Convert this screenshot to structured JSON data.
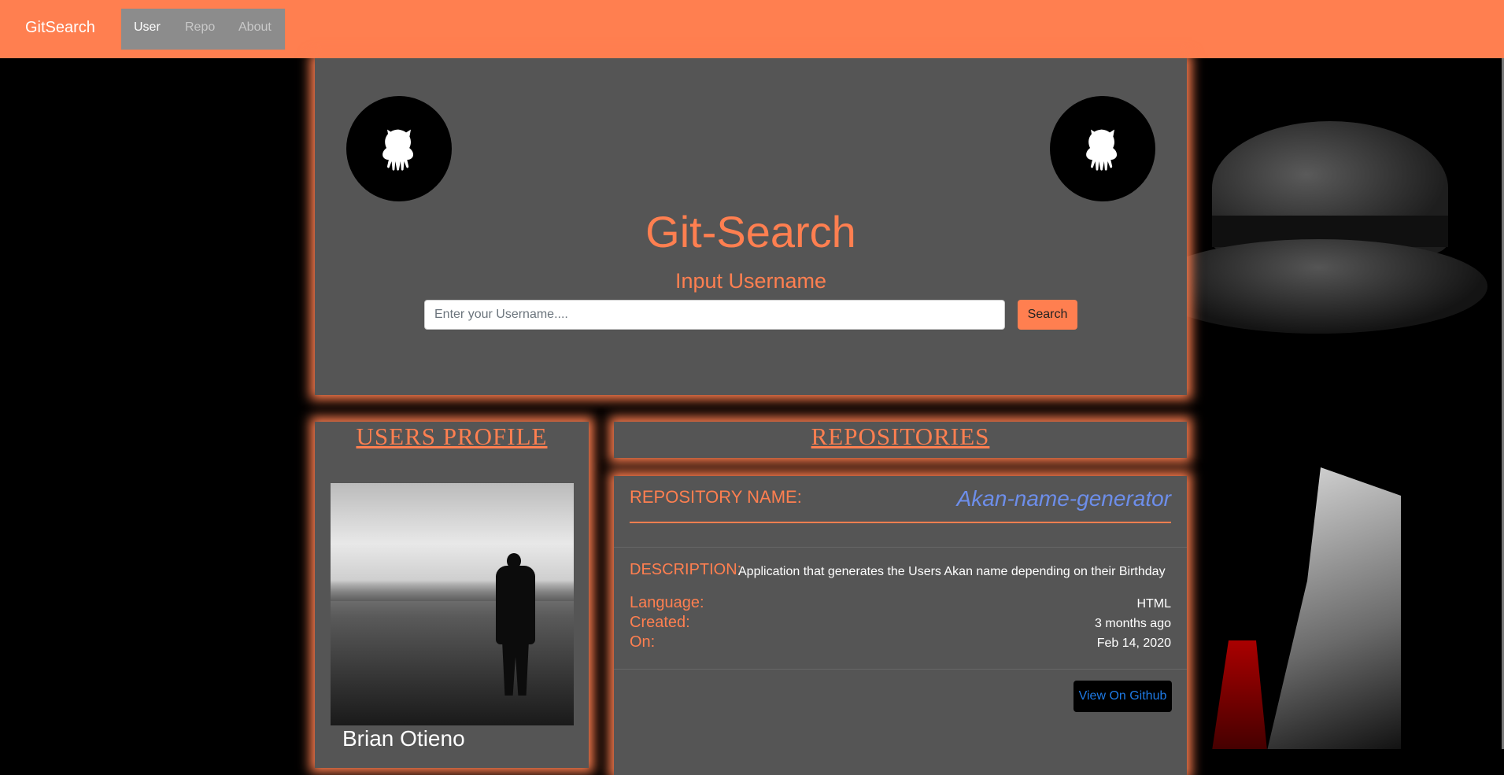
{
  "navbar": {
    "brand": "GitSearch",
    "links": [
      {
        "label": "User",
        "active": true
      },
      {
        "label": "Repo",
        "active": false
      },
      {
        "label": "About",
        "active": false
      }
    ],
    "color": "#ff7f50"
  },
  "hero": {
    "icon": "github-octocat-icon",
    "title": "Git-Search",
    "subtitle": "Input Username",
    "search": {
      "placeholder": "Enter your Username....",
      "value": "",
      "button_label": "Search"
    }
  },
  "profile": {
    "heading": "USERS PROFILE",
    "name": "Brian Otieno"
  },
  "repositories": {
    "heading": "REPOSITORIES",
    "items": [
      {
        "name_label": "REPOSITORY NAME:",
        "name": "Akan-name-generator",
        "description_label": "DESCRIPTION:",
        "description": "Application that generates the Users Akan name depending on their Birthday",
        "language_label": "Language:",
        "language": "HTML",
        "created_label": "Created:",
        "created": "3 months ago",
        "on_label": "On:",
        "on": "Feb 14, 2020",
        "button_label": "View On Github"
      }
    ]
  },
  "colors": {
    "accent": "#ff7f50",
    "panel": "#555555",
    "link": "#6d8eea"
  }
}
